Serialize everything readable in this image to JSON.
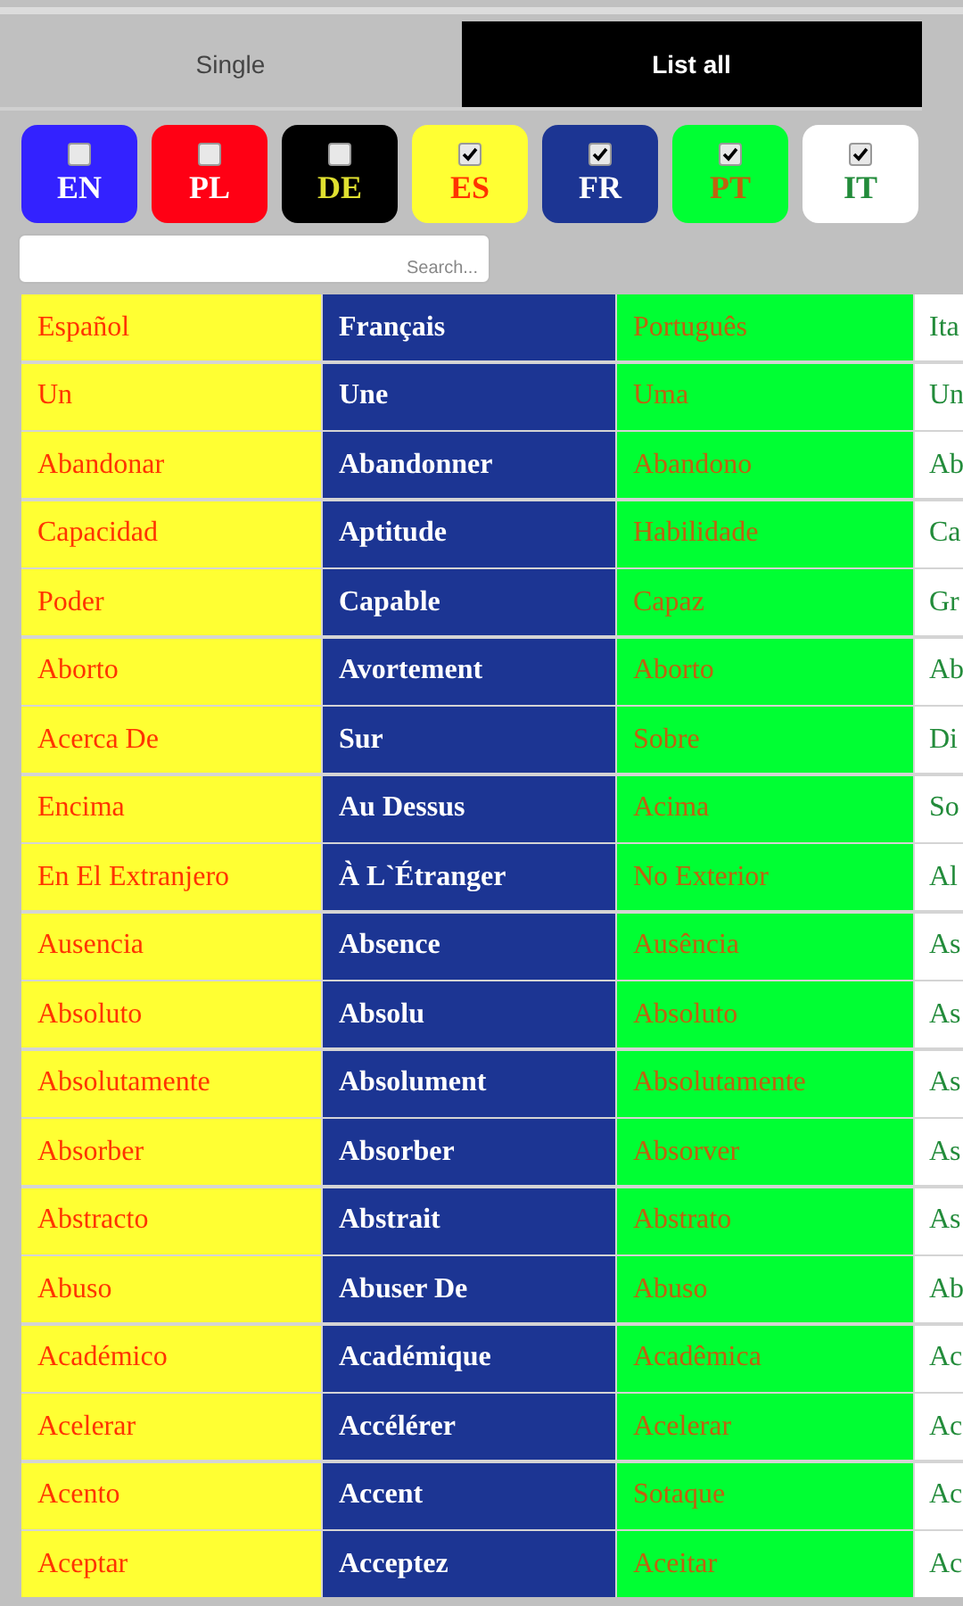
{
  "tabs": [
    {
      "label": "Single",
      "selected": false
    },
    {
      "label": "List all",
      "selected": true
    }
  ],
  "languages": [
    {
      "code": "EN",
      "checked": false,
      "color": "#3322ff"
    },
    {
      "code": "PL",
      "checked": false,
      "color": "#ff0014"
    },
    {
      "code": "DE",
      "checked": false,
      "color": "#000000"
    },
    {
      "code": "ES",
      "checked": true,
      "color": "#ffff33"
    },
    {
      "code": "FR",
      "checked": true,
      "color": "#1c3593"
    },
    {
      "code": "PT",
      "checked": true,
      "color": "#00ff33"
    },
    {
      "code": "IT",
      "checked": true,
      "color": "#ffffff"
    }
  ],
  "search": {
    "placeholder": "Search..."
  },
  "table": {
    "columns": [
      "Español",
      "Français",
      "Português",
      "Ita"
    ],
    "rows": [
      [
        "Un",
        "Une",
        "Uma",
        "Un"
      ],
      [
        "Abandonar",
        "Abandonner",
        "Abandono",
        "Ab"
      ],
      [
        "Capacidad",
        "Aptitude",
        "Habilidade",
        "Ca"
      ],
      [
        "Poder",
        "Capable",
        "Capaz",
        "Gr"
      ],
      [
        "Aborto",
        "Avortement",
        "Aborto",
        "Ab"
      ],
      [
        "Acerca De",
        "Sur",
        "Sobre",
        "Di"
      ],
      [
        "Encima",
        "Au Dessus",
        "Acima",
        "So"
      ],
      [
        "En El Extranjero",
        "À L`Étranger",
        "No Exterior",
        "Al"
      ],
      [
        "Ausencia",
        "Absence",
        "Ausência",
        "As"
      ],
      [
        "Absoluto",
        "Absolu",
        "Absoluto",
        "As"
      ],
      [
        "Absolutamente",
        "Absolument",
        "Absolutamente",
        "As"
      ],
      [
        "Absorber",
        "Absorber",
        "Absorver",
        "As"
      ],
      [
        "Abstracto",
        "Abstrait",
        "Abstrato",
        "As"
      ],
      [
        "Abuso",
        "Abuser De",
        "Abuso",
        "Ab"
      ],
      [
        "Académico",
        "Académique",
        "Acadêmica",
        "Ac"
      ],
      [
        "Acelerar",
        "Accélérer",
        "Acelerar",
        "Ac"
      ],
      [
        "Acento",
        "Accent",
        "Sotaque",
        "Ac"
      ],
      [
        "Aceptar",
        "Acceptez",
        "Aceitar",
        "Ac"
      ]
    ]
  }
}
